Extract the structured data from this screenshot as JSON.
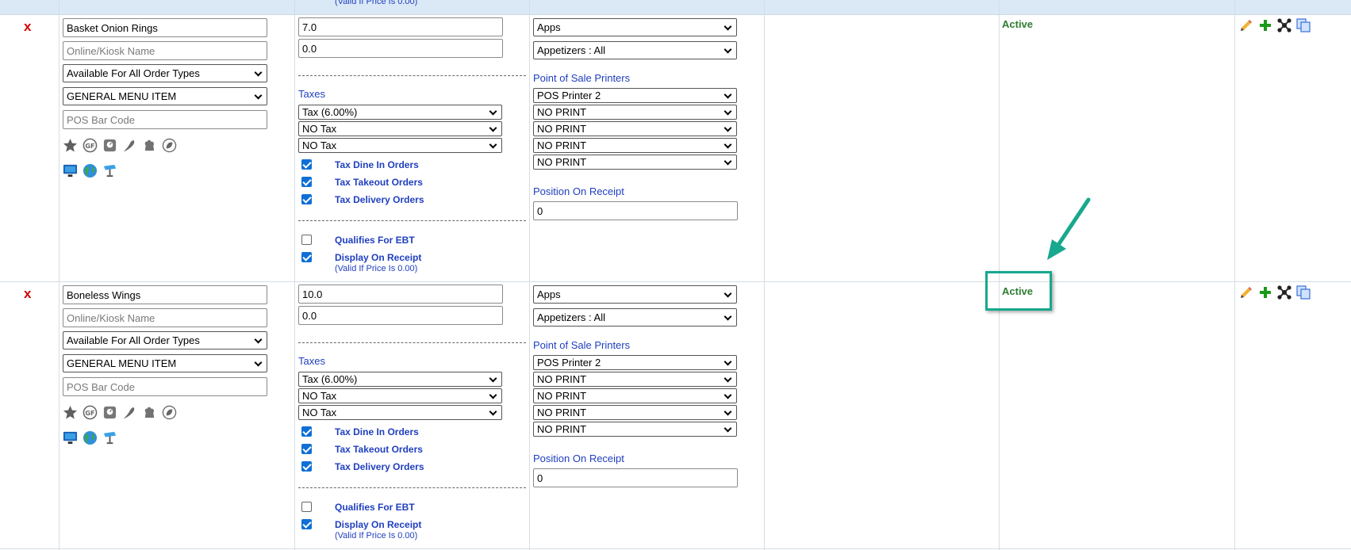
{
  "prev_row": {
    "valid_note": "(Valid If Price Is 0.00)"
  },
  "colors": {
    "accent_label": "#1f3fbf",
    "status_active": "#2e7d32",
    "delete_x": "#d40000",
    "highlight": "#17a88e"
  },
  "rows": [
    {
      "delete_label": "x",
      "name": "Basket Onion Rings",
      "kiosk_placeholder": "Online/Kiosk Name",
      "order_types": "Available For All Order Types",
      "item_type": "GENERAL MENU ITEM",
      "barcode_placeholder": "POS Bar Code",
      "price": "7.0",
      "price2": "0.0",
      "taxes_label": "Taxes",
      "tax1": "Tax (6.00%)",
      "tax2": "NO Tax",
      "tax3": "NO Tax",
      "tax_dine_in": {
        "label": "Tax Dine In Orders",
        "checked": true
      },
      "tax_takeout": {
        "label": "Tax Takeout Orders",
        "checked": true
      },
      "tax_delivery": {
        "label": "Tax Delivery Orders",
        "checked": true
      },
      "ebt": {
        "label": "Qualifies For EBT",
        "checked": false
      },
      "display_receipt": {
        "label": "Display On Receipt",
        "checked": true
      },
      "valid_note": "(Valid If Price Is 0.00)",
      "category": "Apps",
      "subcategory": "Appetizers : All",
      "printers_label": "Point of Sale Printers",
      "printers": [
        "POS Printer 2",
        "NO PRINT",
        "NO PRINT",
        "NO PRINT",
        "NO PRINT"
      ],
      "position_label": "Position On Receipt",
      "position": "0",
      "status": "Active"
    },
    {
      "delete_label": "x",
      "name": "Boneless Wings",
      "kiosk_placeholder": "Online/Kiosk Name",
      "order_types": "Available For All Order Types",
      "item_type": "GENERAL MENU ITEM",
      "barcode_placeholder": "POS Bar Code",
      "price": "10.0",
      "price2": "0.0",
      "taxes_label": "Taxes",
      "tax1": "Tax (6.00%)",
      "tax2": "NO Tax",
      "tax3": "NO Tax",
      "tax_dine_in": {
        "label": "Tax Dine In Orders",
        "checked": true
      },
      "tax_takeout": {
        "label": "Tax Takeout Orders",
        "checked": true
      },
      "tax_delivery": {
        "label": "Tax Delivery Orders",
        "checked": true
      },
      "ebt": {
        "label": "Qualifies For EBT",
        "checked": false
      },
      "display_receipt": {
        "label": "Display On Receipt",
        "checked": true
      },
      "valid_note": "(Valid If Price Is 0.00)",
      "category": "Apps",
      "subcategory": "Appetizers : All",
      "printers_label": "Point of Sale Printers",
      "printers": [
        "POS Printer 2",
        "NO PRINT",
        "NO PRINT",
        "NO PRINT",
        "NO PRINT"
      ],
      "position_label": "Position On Receipt",
      "position": "0",
      "status": "Active"
    }
  ]
}
